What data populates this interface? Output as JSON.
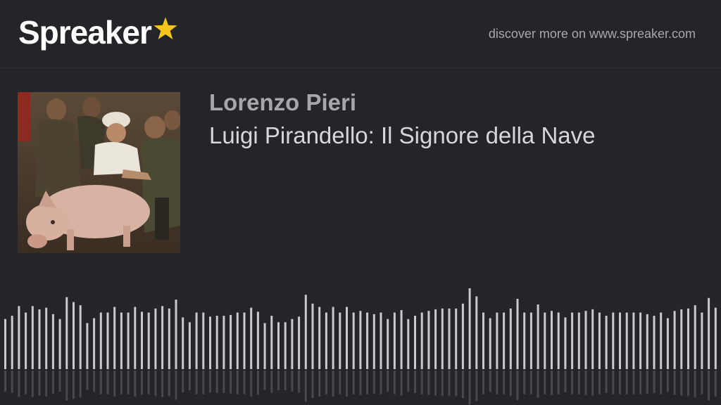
{
  "header": {
    "logo_text": "Spreaker",
    "logo_star_color": "#f5c51c",
    "discover_text": "discover more on www.spreaker.com"
  },
  "episode": {
    "author": "Lorenzo Pieri",
    "title": "Luigi Pirandello: Il Signore della Nave",
    "cover_icon": "episode-cover-painting"
  },
  "waveform": {
    "color": "#c9cacd",
    "levels": [
      0.62,
      0.66,
      0.78,
      0.7,
      0.78,
      0.74,
      0.76,
      0.68,
      0.62,
      0.89,
      0.83,
      0.79,
      0.57,
      0.63,
      0.7,
      0.7,
      0.77,
      0.7,
      0.7,
      0.77,
      0.71,
      0.7,
      0.75,
      0.78,
      0.75,
      0.86,
      0.64,
      0.58,
      0.7,
      0.7,
      0.65,
      0.66,
      0.66,
      0.67,
      0.7,
      0.7,
      0.76,
      0.71,
      0.57,
      0.66,
      0.58,
      0.58,
      0.62,
      0.65,
      0.92,
      0.81,
      0.77,
      0.7,
      0.77,
      0.7,
      0.77,
      0.7,
      0.72,
      0.7,
      0.68,
      0.7,
      0.62,
      0.7,
      0.73,
      0.62,
      0.66,
      0.7,
      0.72,
      0.74,
      0.75,
      0.75,
      0.75,
      0.81,
      1.0,
      0.9,
      0.7,
      0.63,
      0.7,
      0.7,
      0.75,
      0.87,
      0.7,
      0.7,
      0.8,
      0.7,
      0.72,
      0.7,
      0.64,
      0.7,
      0.7,
      0.72,
      0.74,
      0.7,
      0.66,
      0.7,
      0.7,
      0.7,
      0.7,
      0.7,
      0.68,
      0.66,
      0.7,
      0.63,
      0.72,
      0.74,
      0.75,
      0.79,
      0.7,
      0.88,
      0.76,
      0.7,
      0.88,
      0.76
    ]
  }
}
